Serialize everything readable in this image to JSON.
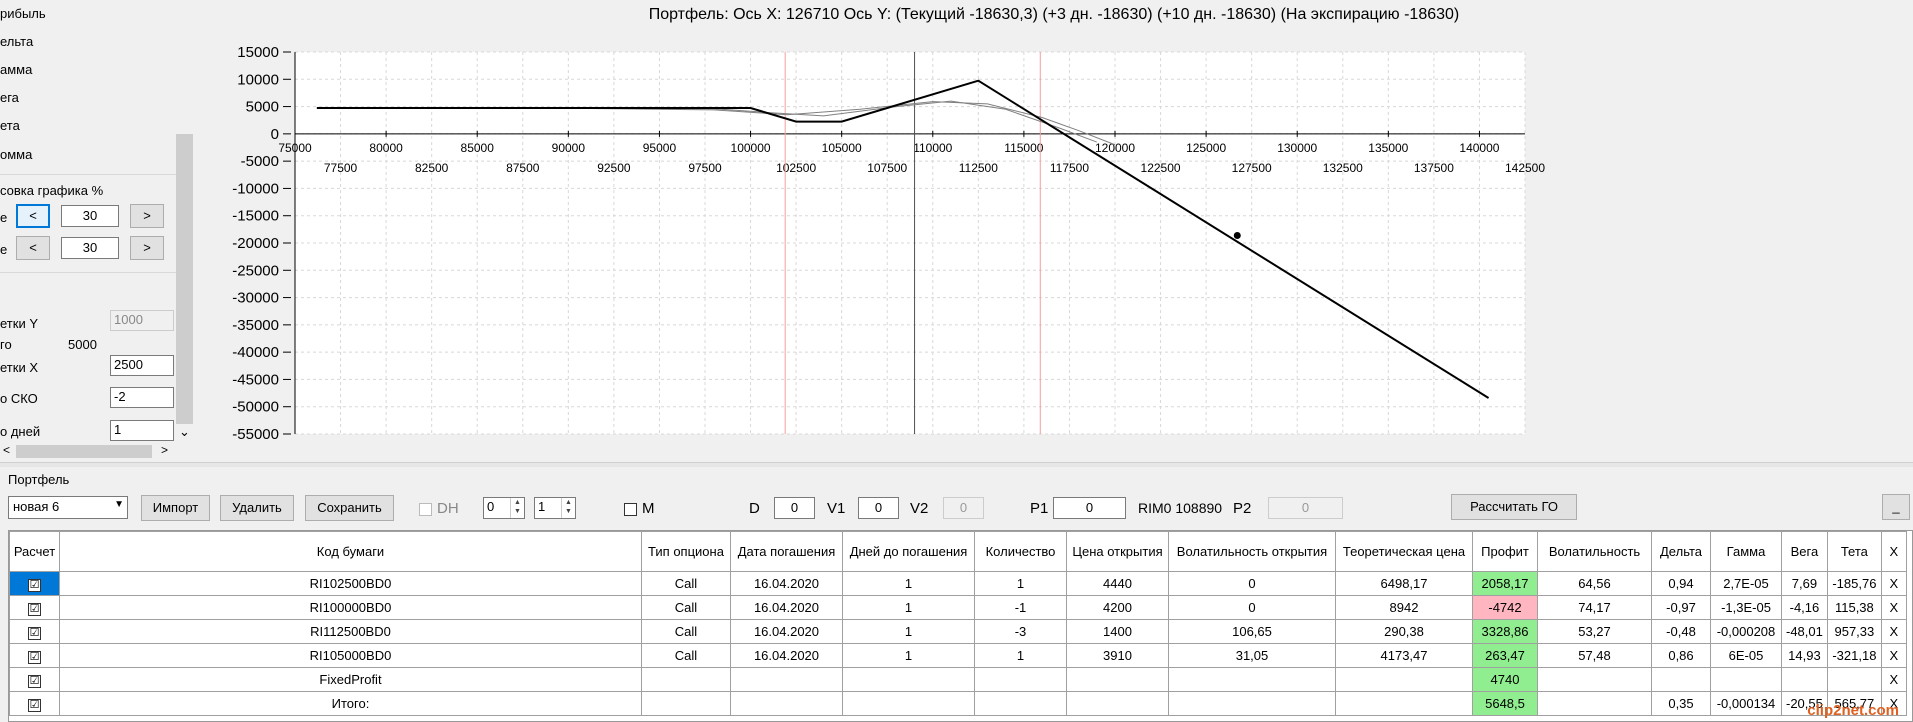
{
  "left_panel": {
    "list_items": [
      "рибыль",
      "ельта",
      "амма",
      "ега",
      "ета",
      "омма"
    ],
    "scale_title": "совка графика %",
    "row1_label": "е",
    "row1_prev": "<",
    "row1_value": "30",
    "row1_next": ">",
    "row2_label": "е",
    "row2_prev": "<",
    "row2_value": "30",
    "row2_next": ">",
    "grid_y_label": "етки Y",
    "grid_y_value": "1000",
    "total_label": "го",
    "total_value": "5000",
    "grid_x_label": "етки X",
    "grid_x_value": "2500",
    "sko_label": "о СКО",
    "sko_value": "-2",
    "days_label": "о дней",
    "days_value": "1",
    "scroll_left": "<",
    "scroll_right": ">",
    "scroll_down": "⌄"
  },
  "chart": {
    "title": "Портфель: Ось X: 126710 Ось Y:  (Текущий -18630,3)  (+3 дн. -18630)  (+10 дн. -18630)  (На экспирацию -18630)"
  },
  "chart_data": {
    "type": "line",
    "title": "Портфель: Ось X: 126710 Ось Y:  (Текущий -18630,3)  (+3 дн. -18630)  (+10 дн. -18630)  (На экспирацию -18630)",
    "xlim": [
      75000,
      142500
    ],
    "ylim": [
      -55000,
      15000
    ],
    "x_ticks_top": [
      75000,
      80000,
      85000,
      90000,
      95000,
      100000,
      105000,
      110000,
      115000,
      120000,
      125000,
      130000,
      135000,
      140000
    ],
    "x_ticks_bottom": [
      77500,
      82500,
      87500,
      92500,
      97500,
      102500,
      107500,
      112500,
      117500,
      122500,
      127500,
      132500,
      137500,
      142500
    ],
    "y_ticks": [
      15000,
      10000,
      5000,
      0,
      -5000,
      -10000,
      -15000,
      -20000,
      -25000,
      -30000,
      -35000,
      -40000,
      -45000,
      -50000,
      -55000
    ],
    "grid": true,
    "series": [
      {
        "color": "#000000",
        "style": "expiration",
        "x": [
          76200,
          100000,
          102500,
          105000,
          112500,
          140500
        ],
        "y": [
          4740,
          4740,
          2240,
          2240,
          9740,
          -48400
        ]
      },
      {
        "color": "#808080",
        "style": "current",
        "x": [
          76200,
          90000,
          98000,
          102000,
          106000,
          110000,
          113000,
          116000,
          118000,
          120000
        ],
        "y": [
          4740,
          4700,
          4400,
          3500,
          4500,
          5900,
          5500,
          3000,
          600,
          -2000
        ]
      },
      {
        "color": "#808080",
        "style": "current-2",
        "x": [
          76200,
          90000,
          98000,
          101000,
          104000,
          108000,
          111000,
          114000,
          117000,
          119000
        ],
        "y": [
          4740,
          4700,
          4600,
          3900,
          3300,
          5000,
          6000,
          4500,
          1000,
          -1500
        ]
      }
    ],
    "marker": {
      "x": 126710,
      "y": -18630
    },
    "vlines": [
      {
        "x": 109000,
        "color": "#505050"
      },
      {
        "x": 101900,
        "color": "#f4a0a0"
      },
      {
        "x": 115900,
        "color": "#f4a0a0"
      }
    ]
  },
  "portfolio": {
    "group_label": "Портфель",
    "name": "новая 6",
    "import_btn": "Импорт",
    "delete_btn": "Удалить",
    "save_btn": "Сохранить",
    "dh_label": "DH",
    "spin1": "0",
    "spin2": "1",
    "m_label": "M",
    "d_label": "D",
    "d_value": "0",
    "v1_label": "V1",
    "v1_value": "0",
    "v2_label": "V2",
    "v2_value": "0",
    "p1_label": "P1",
    "p1_value": "0",
    "rim_label": "RIM0 108890",
    "p2_label": "P2",
    "p2_value": "0",
    "calc_go_btn": "Рассчитать ГО",
    "minimize_btn": "_"
  },
  "table": {
    "headers": [
      "Расчет",
      "Код бумаги",
      "Тип опциона",
      "Дата погашения",
      "Дней до погашения",
      "Количество",
      "Цена открытия",
      "Волатильность открытия",
      "Теоретическая цена",
      "Профит",
      "Волатильность",
      "Дельта",
      "Гамма",
      "Вега",
      "Тета",
      "X"
    ],
    "rows": [
      [
        "☑",
        "RI102500BD0",
        "Call",
        "16.04.2020",
        "1",
        "1",
        "4440",
        "0",
        "6498,17",
        "2058,17",
        "64,56",
        "0,94",
        "2,7E-05",
        "7,69",
        "-185,76",
        "X"
      ],
      [
        "☑",
        "RI100000BD0",
        "Call",
        "16.04.2020",
        "1",
        "-1",
        "4200",
        "0",
        "8942",
        "-4742",
        "74,17",
        "-0,97",
        "-1,3E-05",
        "-4,16",
        "115,38",
        "X"
      ],
      [
        "☑",
        "RI112500BD0",
        "Call",
        "16.04.2020",
        "1",
        "-3",
        "1400",
        "106,65",
        "290,38",
        "3328,86",
        "53,27",
        "-0,48",
        "-0,000208",
        "-48,01",
        "957,33",
        "X"
      ],
      [
        "☑",
        "RI105000BD0",
        "Call",
        "16.04.2020",
        "1",
        "1",
        "3910",
        "31,05",
        "4173,47",
        "263,47",
        "57,48",
        "0,86",
        "6E-05",
        "14,93",
        "-321,18",
        "X"
      ],
      [
        "☑",
        "FixedProfit",
        "",
        "",
        "",
        "",
        "",
        "",
        "",
        "4740",
        "",
        "",
        "",
        "",
        "",
        "X"
      ],
      [
        "☑",
        "Итого:",
        "",
        "",
        "",
        "",
        "",
        "",
        "",
        "5648,5",
        "",
        "0,35",
        "-0,000134",
        "-20,55",
        "565,77",
        "X"
      ]
    ],
    "profit_colors": [
      "pos",
      "neg",
      "pos",
      "pos",
      "pos",
      "pos"
    ]
  },
  "watermark": {
    "a": "clip",
    "b": "2",
    "c": "net.com"
  }
}
